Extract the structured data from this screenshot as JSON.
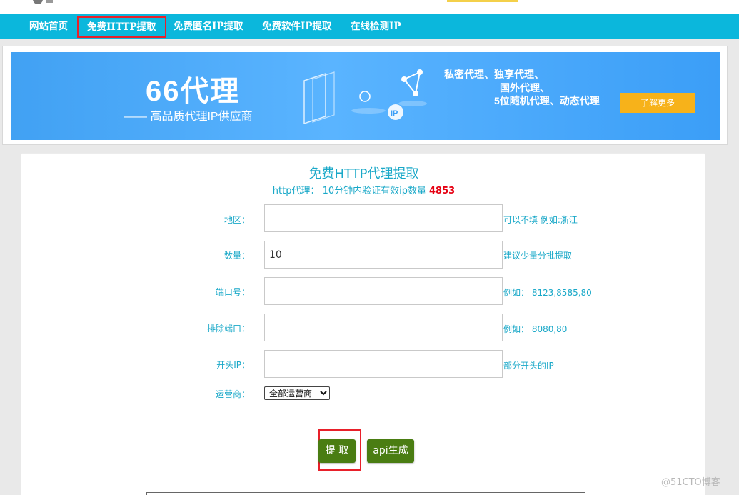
{
  "nav": {
    "items": [
      {
        "label": "网站首页"
      },
      {
        "label": "免费HTTP提取",
        "active": true
      },
      {
        "label": "免费匿名IP提取"
      },
      {
        "label": "免费软件IP提取"
      },
      {
        "label": "在线检测IP"
      }
    ]
  },
  "banner": {
    "title": "66代理",
    "subtitle": "—— 高品质代理IP供应商",
    "features": [
      "私密代理、独享代理、",
      "国外代理、",
      "5位随机代理、动态代理"
    ],
    "button": "了解更多",
    "ip_badge": "IP"
  },
  "form": {
    "title": "免费HTTP代理提取",
    "subtitle": "http代理： 10分钟内验证有效ip数量",
    "count": "4853",
    "fields": [
      {
        "label": "地区：",
        "value": "",
        "hint": "可以不填 例如:浙江"
      },
      {
        "label": "数量：",
        "value": "10",
        "hint": "建议少量分批提取"
      },
      {
        "label": "端口号：",
        "value": "",
        "hint": "例如： 8123,8585,80"
      },
      {
        "label": "排除端口：",
        "value": "",
        "hint": "例如： 8080,80"
      },
      {
        "label": "开头IP：",
        "value": "",
        "hint": "部分开头的IP"
      }
    ],
    "carrier": {
      "label": "运营商：",
      "selected": "全部运营商"
    },
    "buttons": {
      "extract": "提 取",
      "api": "api生成"
    }
  },
  "watermark": "@51CTO博客",
  "colors": {
    "nav": "#0bb7dc",
    "accent_text": "#19a8c8",
    "count": "#e60012",
    "button": "#4a7d12",
    "highlight": "#e8202a",
    "banner_button": "#f7b21a"
  }
}
